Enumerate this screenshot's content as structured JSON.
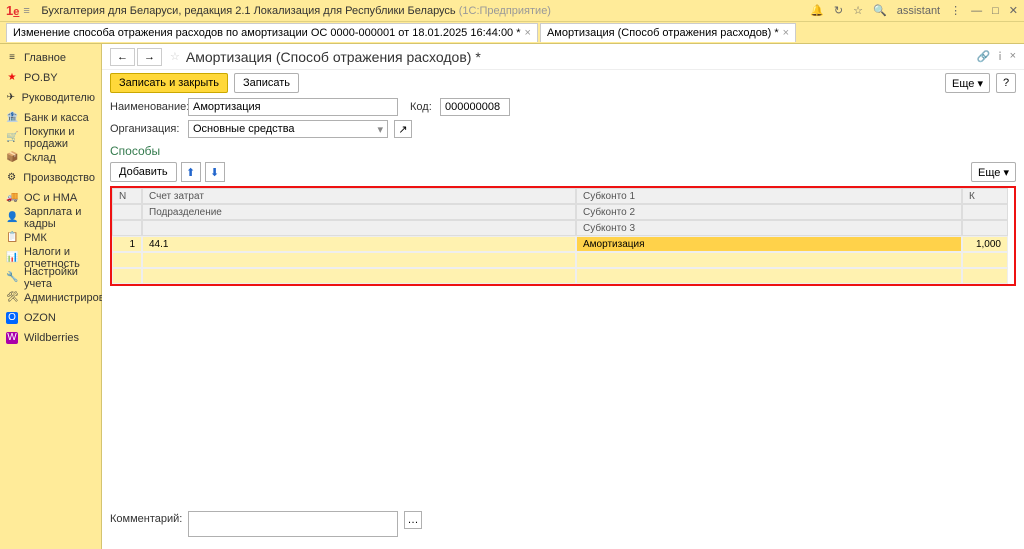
{
  "titlebar": {
    "app": "Бухгалтерия для Беларуси, редакция 2.1 Локализация для Республики Беларусь",
    "mode": "(1С:Предприятие)",
    "user": "assistant"
  },
  "tabs": [
    {
      "label": "Изменение способа отражения расходов по амортизации ОС 0000-000001 от 18.01.2025 16:44:00 *"
    },
    {
      "label": "Амортизация (Способ отражения расходов) *"
    }
  ],
  "sidebar": [
    {
      "ic": "≡",
      "label": "Главное"
    },
    {
      "ic": "★",
      "label": "PO.BY"
    },
    {
      "ic": "✈",
      "label": "Руководителю"
    },
    {
      "ic": "🏦",
      "label": "Банк и касса"
    },
    {
      "ic": "🛒",
      "label": "Покупки и продажи"
    },
    {
      "ic": "📦",
      "label": "Склад"
    },
    {
      "ic": "⚙",
      "label": "Производство"
    },
    {
      "ic": "🚚",
      "label": "ОС и НМА"
    },
    {
      "ic": "👤",
      "label": "Зарплата и кадры"
    },
    {
      "ic": "📋",
      "label": "РМК"
    },
    {
      "ic": "📊",
      "label": "Налоги и отчетность"
    },
    {
      "ic": "🔧",
      "label": "Настройки учета"
    },
    {
      "ic": "🛠",
      "label": "Администрирование"
    },
    {
      "ic": "O",
      "label": "OZON"
    },
    {
      "ic": "W",
      "label": "Wildberries"
    }
  ],
  "header": {
    "title": "Амортизация (Способ отражения расходов) *"
  },
  "toolbar": {
    "save_close": "Записать и закрыть",
    "save": "Записать",
    "more": "Еще",
    "help": "?"
  },
  "form": {
    "name_lbl": "Наименование:",
    "name_val": "Амортизация",
    "code_lbl": "Код:",
    "code_val": "000000008",
    "org_lbl": "Организация:",
    "org_val": "Основные средства"
  },
  "section": "Способы",
  "subtb": {
    "add": "Добавить",
    "more": "Еще"
  },
  "table": {
    "head_n": "N",
    "head_acc": "Счет затрат",
    "head_sub": "Подразделение",
    "head_s1": "Субконто 1",
    "head_s2": "Субконто 2",
    "head_s3": "Субконто 3",
    "head_k": "К",
    "row": {
      "n": "1",
      "acc": "44.1",
      "s1": "Амортизация",
      "k": "1,000"
    }
  },
  "footer": {
    "comment_lbl": "Комментарий:"
  }
}
